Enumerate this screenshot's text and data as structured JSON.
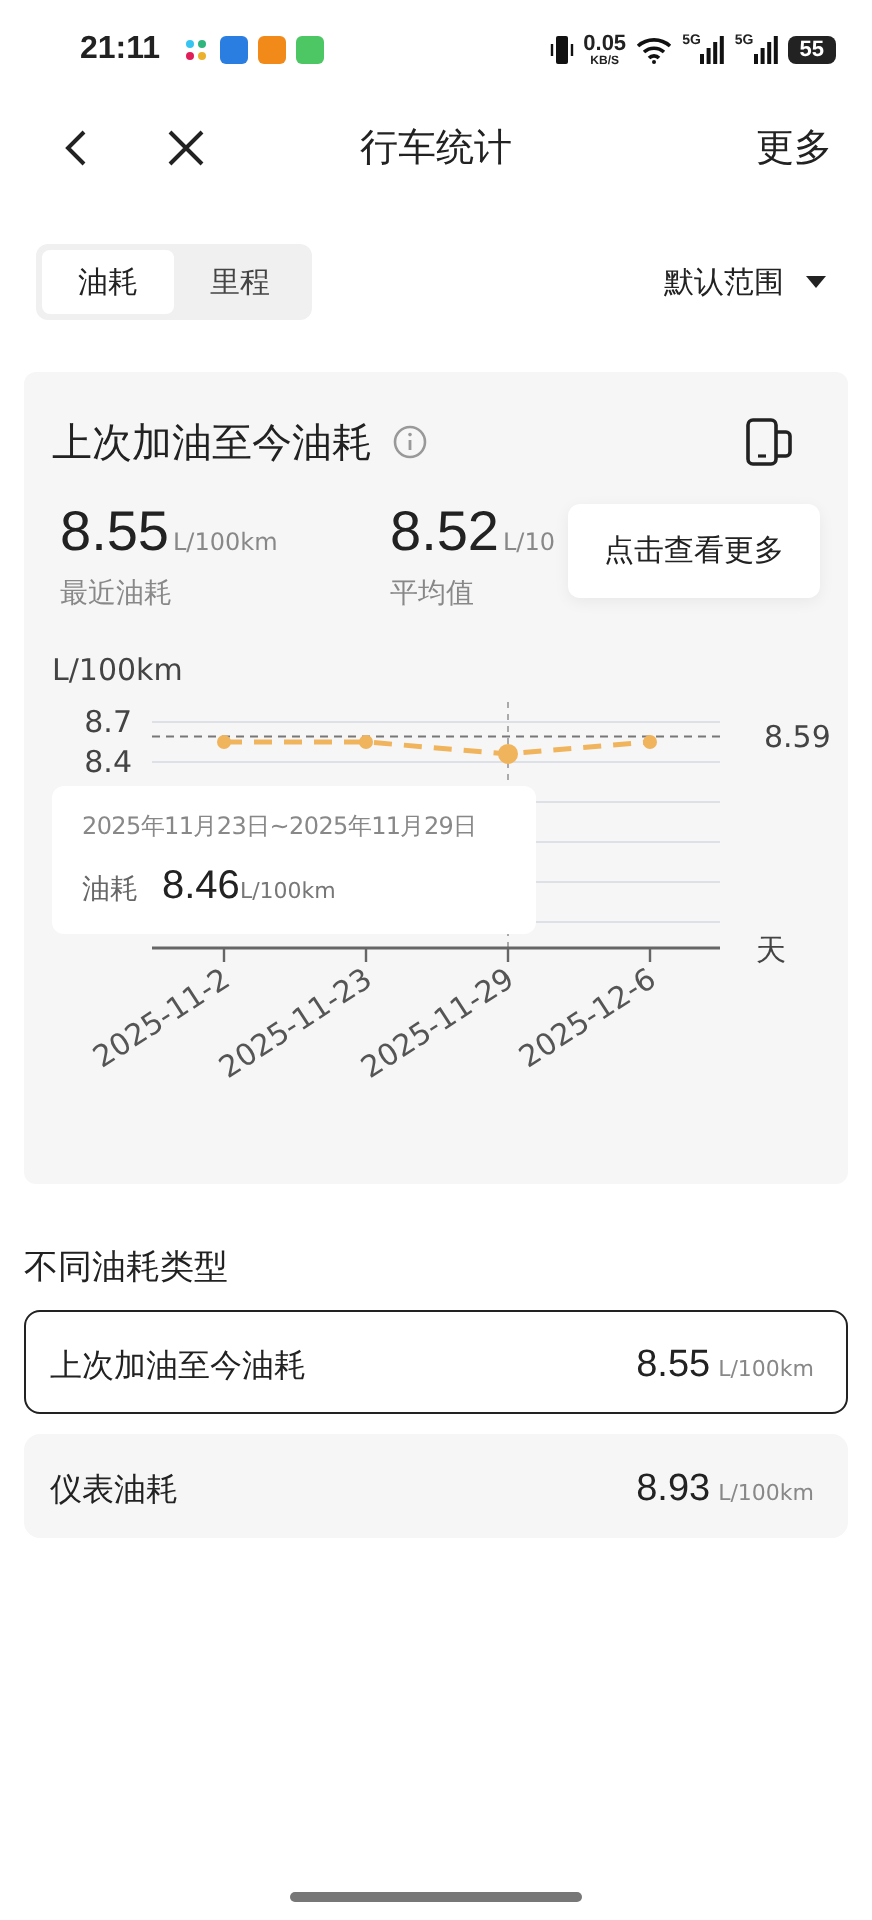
{
  "status_bar": {
    "time": "21:11",
    "speed": "0.05",
    "speed_unit": "KB/S",
    "network_1": "5G",
    "network_2": "5G",
    "battery": "55"
  },
  "nav": {
    "title": "行车统计",
    "more": "更多"
  },
  "tabs": [
    {
      "label": "油耗",
      "selected": true
    },
    {
      "label": "里程",
      "selected": false
    }
  ],
  "range": {
    "label": "默认范围"
  },
  "card": {
    "title": "上次加油至今油耗",
    "popover": "点击查看更多",
    "stats": [
      {
        "value": "8.55",
        "unit": "L/100km",
        "label": "最近油耗"
      },
      {
        "value": "8.52",
        "unit": "L/10",
        "label": "平均值"
      }
    ],
    "chart_data": {
      "type": "line",
      "ylabel": "L/100km",
      "xlabel": "天",
      "categories": [
        "2025-11-2",
        "2025-11-23",
        "2025-11-29",
        "2025-12-6"
      ],
      "series": [
        {
          "color": "#f0b45c",
          "line_style": "dashed",
          "marker": "circle",
          "values": [
            8.55,
            8.55,
            8.46,
            8.55
          ]
        }
      ],
      "ylim": [
        7.0,
        8.7
      ],
      "yticks": [
        8.7,
        8.4
      ],
      "ref_lines": [
        {
          "axis": "y",
          "value": 8.59,
          "label": "8.59"
        },
        {
          "axis": "x",
          "value": "2025-11-29"
        }
      ]
    },
    "tooltip": {
      "date": "2025年11月23日~2025年11月29日",
      "label": "油耗",
      "value": "8.46",
      "unit": "L/100km"
    }
  },
  "types": {
    "title": "不同油耗类型",
    "rows": [
      {
        "label": "上次加油至今油耗",
        "value": "8.55",
        "unit": "L/100km",
        "selected": true
      },
      {
        "label": "仪表油耗",
        "value": "8.93",
        "unit": "L/100km",
        "selected": false
      }
    ]
  }
}
